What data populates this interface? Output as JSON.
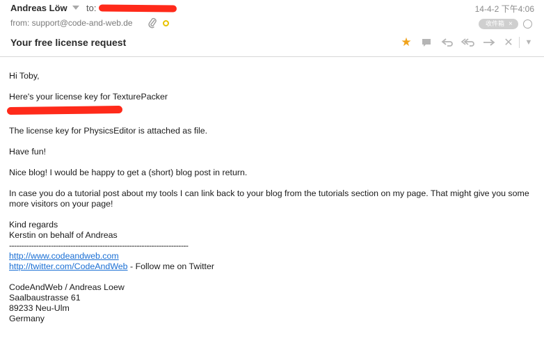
{
  "header": {
    "sender": "Andreas Löw",
    "to_label": "to:",
    "date": "14-4-2 下午4:06",
    "from": "from: support@code-and-web.de",
    "inbox_badge": "收件箱",
    "inbox_badge_close": "×",
    "subject": "Your free license request"
  },
  "toolbar": {
    "star": "★",
    "delete": "✕",
    "more": "▼",
    "accent_color": "#f0a31c"
  },
  "email": {
    "greeting": "Hi Toby,",
    "line1": "Here's your license key for TexturePacker",
    "line2": "The license key for PhysicsEditor is attached as file.",
    "line3": "Have fun!",
    "line4": "Nice blog! I would be happy to get a (short) blog post in return.",
    "line5": "In case you do a tutorial post about my tools I can link back to your blog from the tutorials section on my page. That might give you some more visitors on your page!",
    "sign1": "Kind regards",
    "sign2": "Kerstin on behalf of Andreas",
    "divider": "-------------------------------------------------------------------------",
    "link1": "http://www.codeandweb.com",
    "link2": "http://twitter.com/CodeAndWeb",
    "link2_suffix": " - Follow me on Twitter",
    "addr1": "CodeAndWeb / Andreas Loew",
    "addr2": "Saalbaustrasse 61",
    "addr3": "89233 Neu-Ulm",
    "addr4": "Germany"
  },
  "colors": {
    "redaction": "#ff2a1a",
    "link": "#1a6fd4"
  }
}
